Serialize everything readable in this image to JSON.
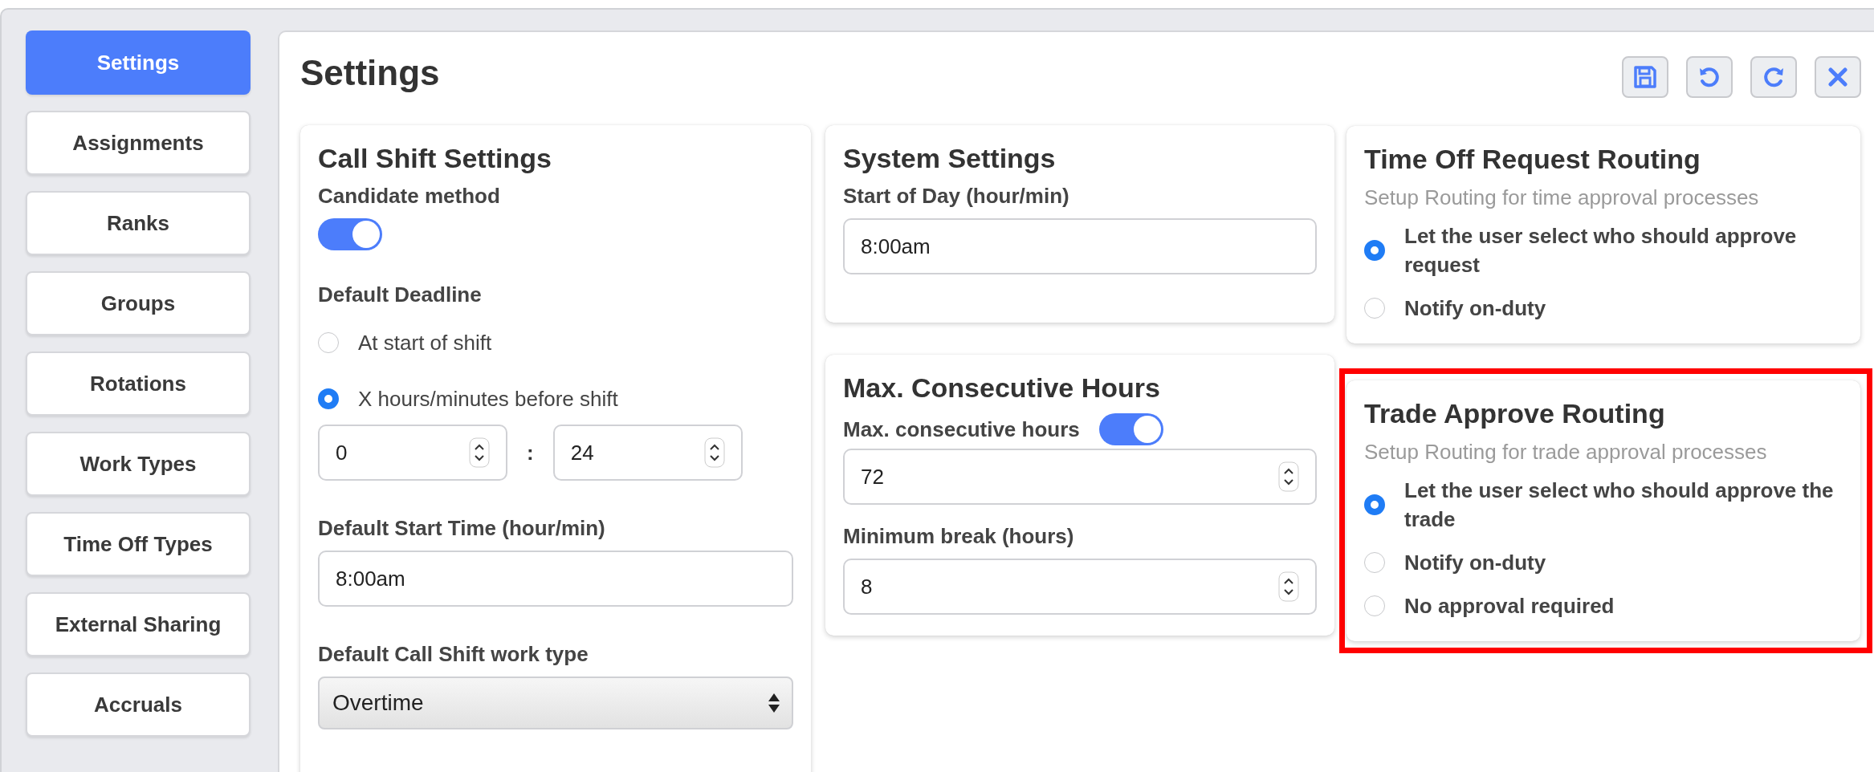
{
  "sidebar": {
    "items": [
      {
        "label": "Settings",
        "selected": true
      },
      {
        "label": "Assignments",
        "selected": false
      },
      {
        "label": "Ranks",
        "selected": false
      },
      {
        "label": "Groups",
        "selected": false
      },
      {
        "label": "Rotations",
        "selected": false
      },
      {
        "label": "Work Types",
        "selected": false
      },
      {
        "label": "Time Off Types",
        "selected": false
      },
      {
        "label": "External Sharing",
        "selected": false
      },
      {
        "label": "Accruals",
        "selected": false
      }
    ]
  },
  "page": {
    "title": "Settings",
    "toolbar": [
      {
        "kind": "save"
      },
      {
        "kind": "undo"
      },
      {
        "kind": "redo"
      },
      {
        "kind": "close"
      }
    ]
  },
  "call_shift": {
    "title": "Call Shift Settings",
    "candidate_method": {
      "label": "Candidate method",
      "on": true
    },
    "default_deadline": {
      "label": "Default Deadline",
      "options": [
        {
          "label": "At start of shift",
          "selected": false
        },
        {
          "label": "X hours/minutes before shift",
          "selected": true
        }
      ],
      "hours": "0",
      "separator": ":",
      "minutes": "24"
    },
    "start_time": {
      "label": "Default Start Time (hour/min)",
      "value": "8:00am"
    },
    "work_type": {
      "label": "Default Call Shift work type",
      "value": "Overtime"
    }
  },
  "system_settings": {
    "title": "System Settings",
    "start_of_day": {
      "label": "Start of Day (hour/min)",
      "value": "8:00am"
    }
  },
  "max_hours": {
    "title": "Max. Consecutive Hours",
    "max_consecutive": {
      "label": "Max. consecutive hours",
      "on": true,
      "value": "72"
    },
    "minimum_break": {
      "label": "Minimum break (hours)",
      "value": "8"
    }
  },
  "time_off_routing": {
    "title": "Time Off Request Routing",
    "subtitle": "Setup Routing for time approval processes",
    "options": [
      {
        "label": "Let the user select who should approve request",
        "selected": true
      },
      {
        "label": "Notify on-duty",
        "selected": false
      }
    ]
  },
  "trade_routing": {
    "title": "Trade Approve Routing",
    "subtitle": "Setup Routing for trade approval processes",
    "highlighted": true,
    "options": [
      {
        "label": "Let the user select who should approve the trade",
        "selected": true
      },
      {
        "label": "Notify on-duty",
        "selected": false
      },
      {
        "label": "No approval required",
        "selected": false
      }
    ]
  }
}
